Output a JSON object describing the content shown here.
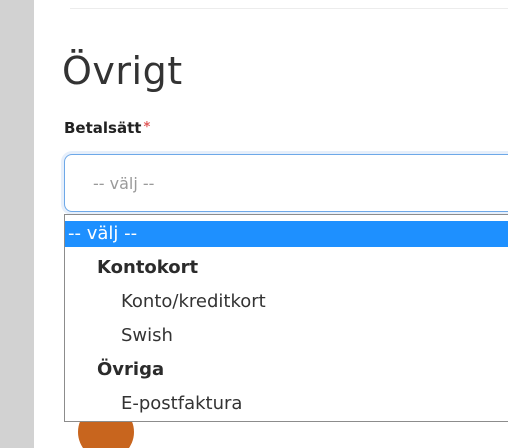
{
  "section": {
    "title": "Övrigt"
  },
  "payment_field": {
    "label": "Betalsätt",
    "required_marker": "*",
    "selected_value": "-- välj --"
  },
  "dropdown": {
    "placeholder_option": "-- välj --",
    "groups": [
      {
        "label": "Kontokort",
        "options": [
          "Konto/kreditkort",
          "Swish"
        ]
      },
      {
        "label": "Övriga",
        "options": [
          "E-postfaktura"
        ]
      }
    ],
    "highlight_color": "#1e90ff"
  },
  "colors": {
    "required": "#e05a5a",
    "focus_border": "#6da8e8",
    "sidebar": "#d2d2d2"
  }
}
